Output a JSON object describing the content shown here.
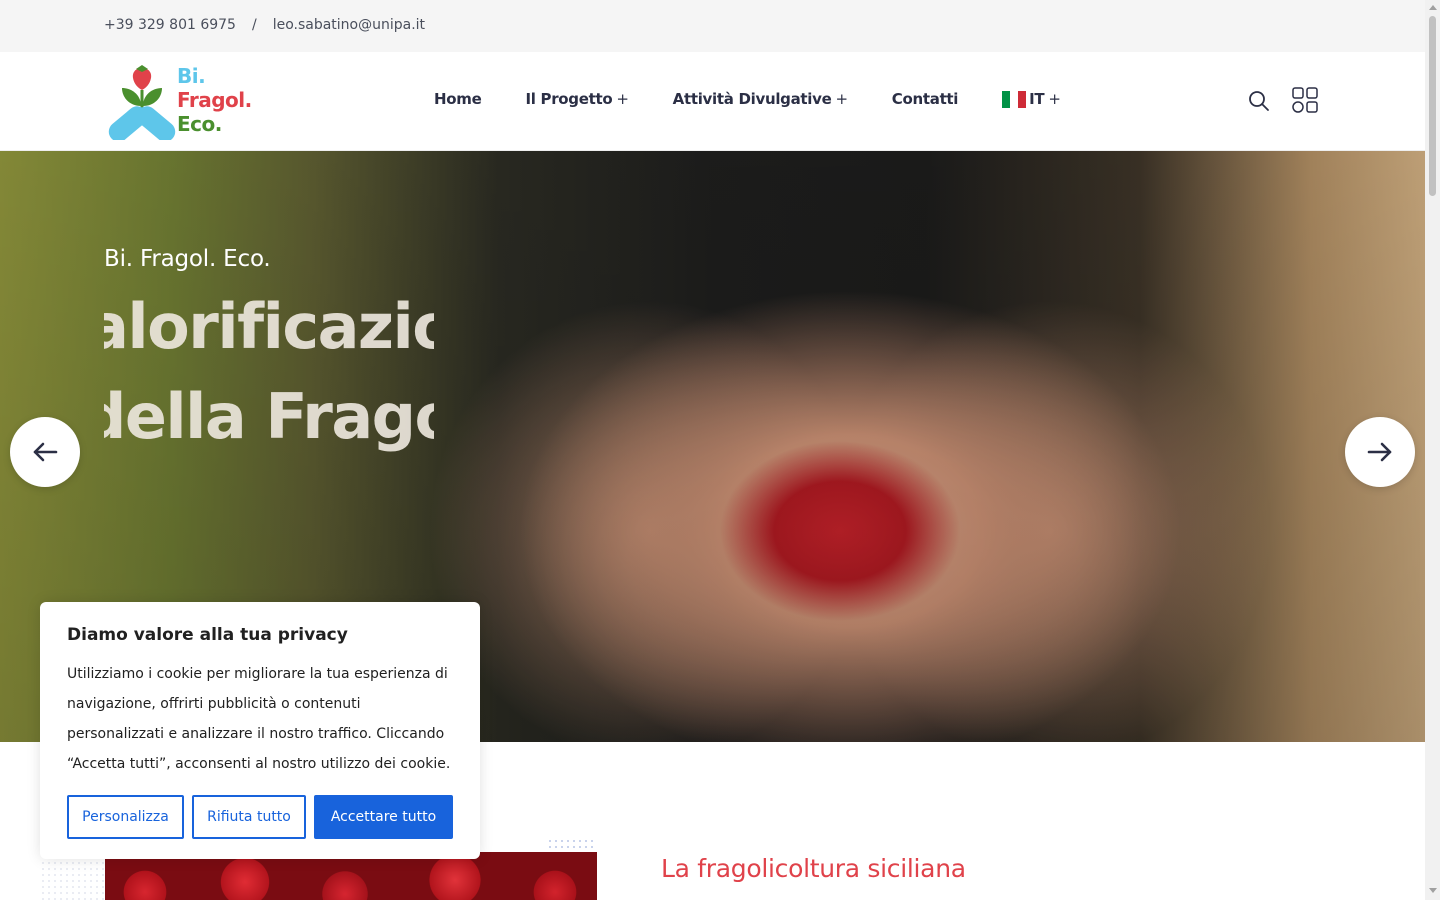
{
  "topbar": {
    "phone": "+39 329 801 6975",
    "separator": "/",
    "email": "leo.sabatino@unipa.it"
  },
  "logo": {
    "line1": "Bi.",
    "line2": "Fragol.",
    "line3": "Eco.",
    "colors": {
      "blue": "#5ec6ea",
      "red": "#e0424a",
      "green": "#4a8f2e"
    }
  },
  "nav": {
    "items": [
      {
        "label": "Home",
        "has_submenu": false
      },
      {
        "label": "Il Progetto",
        "has_submenu": true
      },
      {
        "label": "Attività Divulgative",
        "has_submenu": true
      },
      {
        "label": "Contatti",
        "has_submenu": false
      }
    ],
    "language": {
      "label": "IT",
      "icon": "italy-flag-icon"
    },
    "submenu_indicator": "+"
  },
  "header_icons": {
    "search": "search-icon",
    "menu": "grid-menu-icon"
  },
  "hero": {
    "subtitle": "Bi. Fragol. Eco.",
    "headline_line1": "Valorificazione",
    "headline_line2": "della Fragola",
    "prev_icon": "arrow-left-icon",
    "next_icon": "arrow-right-icon"
  },
  "about": {
    "title": "La fragolicoltura siciliana"
  },
  "cookie": {
    "title": "Diamo valore alla tua privacy",
    "body": "Utilizziamo i cookie per migliorare la tua esperienza di navigazione, offrirti pubblicità o contenuti personalizzati e analizzare il nostro traffico. Cliccando “Accetta tutti”, acconsenti al nostro utilizzo dei cookie.",
    "customize_label": "Personalizza",
    "reject_label": "Rifiuta tutto",
    "accept_label": "Accettare tutto",
    "accent_color": "#1863dc"
  }
}
